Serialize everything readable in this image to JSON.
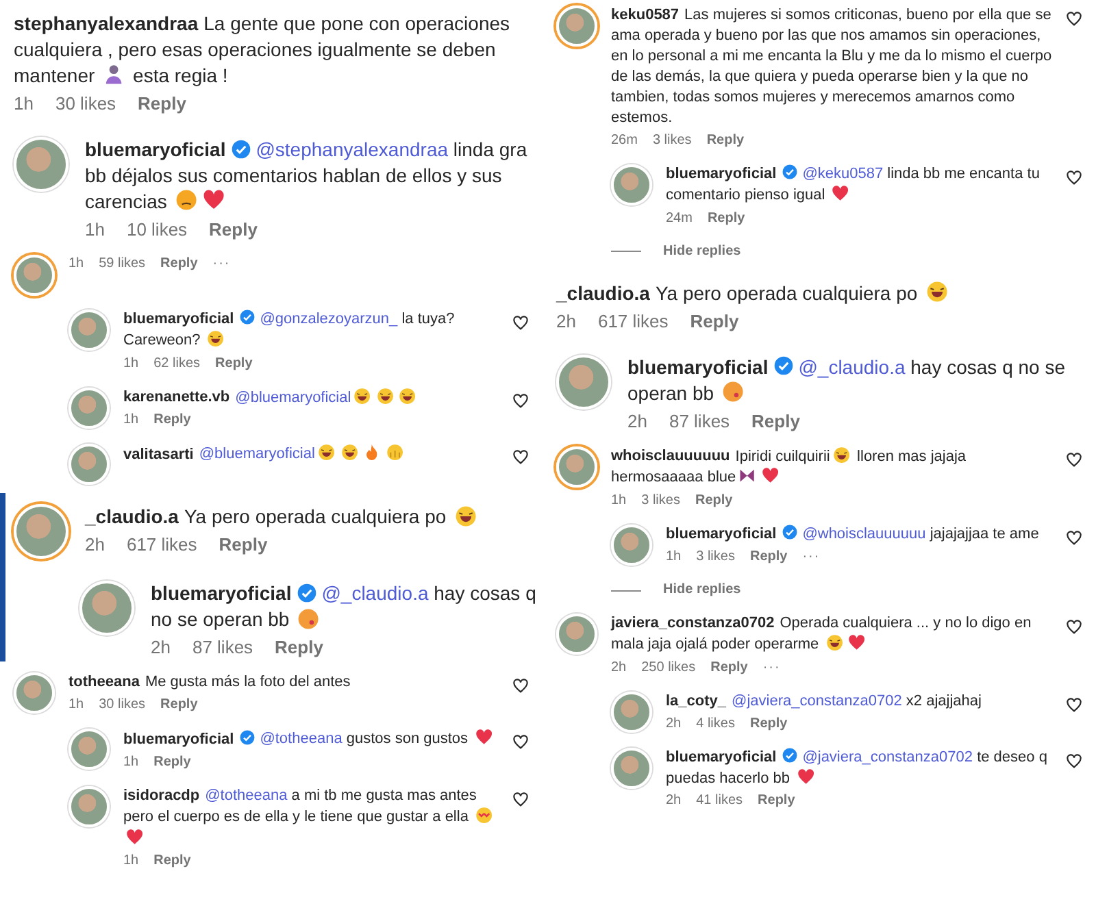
{
  "columns": [
    {
      "panels": [
        {
          "kind": "large",
          "comments": [
            {
              "kind": "comment",
              "user": "stephanyalexandraa",
              "avatar": false,
              "verified": false,
              "reply": false,
              "heart": false,
              "segments": [
                {
                  "kind": "text",
                  "text": "La gente que pone con operaciones cualquiera , pero esas operaciones igualmente se deben mantener "
                },
                {
                  "kind": "person"
                },
                {
                  "kind": "text",
                  "text": " esta regia !"
                }
              ],
              "meta": {
                "time": "1h",
                "likes": "30 likes",
                "reply": "Reply"
              }
            },
            {
              "kind": "comment",
              "user": "bluemaryoficial",
              "avatar": true,
              "ring": false,
              "verified": true,
              "reply": false,
              "heart": false,
              "segments": [
                {
                  "kind": "mention",
                  "text": "@stephanyalexandraa"
                },
                {
                  "kind": "text",
                  "text": " linda gra"
                },
                {
                  "kind": "break"
                },
                {
                  "kind": "text",
                  "text": "bb déjalos sus comentarios hablan de ellos y sus carencias "
                },
                {
                  "kind": "pensive"
                },
                {
                  "kind": "heart"
                }
              ],
              "meta": {
                "time": "1h",
                "likes": "10 likes",
                "reply": "Reply"
              }
            }
          ]
        },
        {
          "kind": "small",
          "comments": [
            {
              "kind": "comment",
              "avatar": true,
              "ring": true,
              "verified": false,
              "reply": false,
              "heart": false,
              "meta": {
                "time": "1h",
                "likes": "59 likes",
                "reply": "Reply",
                "more": "···"
              }
            },
            {
              "kind": "comment",
              "user": "bluemaryoficial",
              "avatar": true,
              "ring": false,
              "verified": true,
              "reply": true,
              "heart": true,
              "segments": [
                {
                  "kind": "mention",
                  "text": "@gonzalezoyarzun_"
                },
                {
                  "kind": "text",
                  "text": " la tuya?"
                },
                {
                  "kind": "break"
                },
                {
                  "kind": "text",
                  "text": "Careweon? "
                },
                {
                  "kind": "laugh"
                }
              ],
              "meta": {
                "time": "1h",
                "likes": "62 likes",
                "reply": "Reply"
              }
            },
            {
              "kind": "comment",
              "user": "karenanette.vb",
              "avatar": true,
              "ring": false,
              "verified": false,
              "reply": true,
              "heart": true,
              "segments": [
                {
                  "kind": "mention",
                  "text": "@bluemaryoficial"
                },
                {
                  "kind": "laugh"
                },
                {
                  "kind": "laugh"
                },
                {
                  "kind": "laugh"
                }
              ],
              "meta": {
                "time": "1h",
                "reply": "Reply"
              }
            },
            {
              "kind": "comment",
              "user": "valitasarti",
              "avatar": true,
              "ring": false,
              "verified": false,
              "reply": true,
              "heart": true,
              "segments": [
                {
                  "kind": "mention",
                  "text": "@bluemaryoficial"
                },
                {
                  "kind": "laugh"
                },
                {
                  "kind": "laugh"
                },
                {
                  "kind": "fire"
                },
                {
                  "kind": "hands"
                }
              ]
            }
          ]
        },
        {
          "kind": "large",
          "left_bar": true,
          "comments": [
            {
              "kind": "comment",
              "user": "_claudio.a",
              "avatar": true,
              "ring": true,
              "verified": false,
              "reply": false,
              "heart": false,
              "segments": [
                {
                  "kind": "text",
                  "text": "Ya pero operada cualquiera po "
                },
                {
                  "kind": "laugh"
                }
              ],
              "meta": {
                "time": "2h",
                "likes": "617 likes",
                "reply": "Reply"
              }
            },
            {
              "kind": "comment",
              "user": "bluemaryoficial",
              "avatar": true,
              "ring": false,
              "verified": true,
              "reply": true,
              "heart": false,
              "segments": [
                {
                  "kind": "mention",
                  "text": "@_claudio.a"
                },
                {
                  "kind": "text",
                  "text": " hay cosas q no se operan bb "
                },
                {
                  "kind": "kiss"
                }
              ],
              "meta": {
                "time": "2h",
                "likes": "87 likes",
                "reply": "Reply"
              }
            }
          ]
        },
        {
          "kind": "small",
          "comments": [
            {
              "kind": "comment",
              "user": "totheeana",
              "avatar": true,
              "ring": false,
              "verified": false,
              "reply": false,
              "heart": true,
              "segments": [
                {
                  "kind": "text",
                  "text": "Me gusta más la foto del antes"
                }
              ],
              "meta": {
                "time": "1h",
                "likes": "30 likes",
                "reply": "Reply"
              }
            },
            {
              "kind": "comment",
              "user": "bluemaryoficial",
              "avatar": true,
              "ring": false,
              "verified": true,
              "reply": true,
              "heart": true,
              "segments": [
                {
                  "kind": "mention",
                  "text": "@totheeana"
                },
                {
                  "kind": "text",
                  "text": " gustos son gustos "
                },
                {
                  "kind": "heart"
                }
              ],
              "meta": {
                "time": "1h",
                "reply": "Reply"
              }
            },
            {
              "kind": "comment",
              "user": "isidoracdp",
              "avatar": true,
              "ring": false,
              "verified": false,
              "reply": true,
              "heart": true,
              "segments": [
                {
                  "kind": "mention",
                  "text": "@totheeana"
                },
                {
                  "kind": "text",
                  "text": " a mi tb me gusta mas antes pero el cuerpo es de ella y le tiene que gustar a ella "
                },
                {
                  "kind": "heart_eyes"
                },
                {
                  "kind": "heart"
                }
              ],
              "meta": {
                "time": "1h",
                "reply": "Reply"
              }
            }
          ]
        }
      ]
    },
    {
      "panels": [
        {
          "kind": "small",
          "comments": [
            {
              "kind": "comment",
              "user": "keku0587",
              "avatar": true,
              "ring": true,
              "verified": false,
              "reply": false,
              "heart": true,
              "segments": [
                {
                  "kind": "text",
                  "text": "Las mujeres si somos criticonas, bueno por ella que se ama operada y bueno por las que nos amamos sin operaciones, en lo personal a mi me encanta la Blu y me da lo mismo el cuerpo de las demás, la que quiera y pueda operarse bien y la que no tambien, todas somos mujeres y merecemos amarnos como estemos."
                }
              ],
              "meta": {
                "time": "26m",
                "likes": "3 likes",
                "reply": "Reply"
              }
            },
            {
              "kind": "comment",
              "user": "bluemaryoficial",
              "avatar": true,
              "ring": false,
              "verified": true,
              "reply": true,
              "heart": true,
              "segments": [
                {
                  "kind": "mention",
                  "text": "@keku0587"
                },
                {
                  "kind": "text",
                  "text": " linda bb me encanta tu comentario pienso igual "
                },
                {
                  "kind": "heart"
                }
              ],
              "meta": {
                "time": "24m",
                "reply": "Reply"
              }
            },
            {
              "kind": "hide",
              "text": "Hide replies"
            }
          ]
        },
        {
          "kind": "large",
          "comments": [
            {
              "kind": "comment",
              "user": "_claudio.a",
              "avatar": false,
              "verified": false,
              "reply": false,
              "heart": false,
              "segments": [
                {
                  "kind": "text",
                  "text": "Ya pero operada cualquiera po "
                },
                {
                  "kind": "laugh"
                }
              ],
              "meta": {
                "time": "2h",
                "likes": "617 likes",
                "reply": "Reply"
              }
            },
            {
              "kind": "comment",
              "user": "bluemaryoficial",
              "avatar": true,
              "ring": false,
              "verified": true,
              "reply": false,
              "heart": false,
              "segments": [
                {
                  "kind": "mention",
                  "text": "@_claudio.a"
                },
                {
                  "kind": "text",
                  "text": " hay cosas q no se operan bb "
                },
                {
                  "kind": "kiss"
                }
              ],
              "meta": {
                "time": "2h",
                "likes": "87 likes",
                "reply": "Reply"
              }
            }
          ]
        },
        {
          "kind": "small",
          "comments": [
            {
              "kind": "comment",
              "user": "whoisclauuuuuu",
              "avatar": true,
              "ring": true,
              "verified": false,
              "reply": false,
              "heart": true,
              "segments": [
                {
                  "kind": "text",
                  "text": "Ipiridi cuilquirii"
                },
                {
                  "kind": "laugh"
                },
                {
                  "kind": "text",
                  "text": " lloren mas jajaja hermosaaaaa blue"
                },
                {
                  "kind": "butterfly"
                },
                {
                  "kind": "heart"
                }
              ],
              "meta": {
                "time": "1h",
                "likes": "3 likes",
                "reply": "Reply"
              }
            },
            {
              "kind": "comment",
              "user": "bluemaryoficial",
              "avatar": true,
              "ring": false,
              "verified": true,
              "reply": true,
              "heart": true,
              "segments": [
                {
                  "kind": "mention",
                  "text": "@whoisclauuuuuu"
                },
                {
                  "kind": "text",
                  "text": " jajajajjaa te ame"
                }
              ],
              "meta": {
                "time": "1h",
                "likes": "3 likes",
                "reply": "Reply",
                "more": "···"
              }
            },
            {
              "kind": "hide",
              "text": "Hide replies"
            },
            {
              "kind": "comment",
              "user": "javiera_constanza0702",
              "avatar": true,
              "ring": false,
              "verified": false,
              "reply": false,
              "heart": true,
              "segments": [
                {
                  "kind": "text",
                  "text": "Operada cualquiera ... y no lo digo en mala jaja ojalá poder operarme "
                },
                {
                  "kind": "laugh"
                },
                {
                  "kind": "heart"
                }
              ],
              "meta": {
                "time": "2h",
                "likes": "250 likes",
                "reply": "Reply",
                "more": "···"
              }
            },
            {
              "kind": "comment",
              "user": "la_coty_",
              "avatar": true,
              "ring": false,
              "verified": false,
              "reply": true,
              "heart": true,
              "segments": [
                {
                  "kind": "mention",
                  "text": "@javiera_constanza0702"
                },
                {
                  "kind": "text",
                  "text": " x2 ajajjahaj"
                }
              ],
              "meta": {
                "time": "2h",
                "likes": "4 likes",
                "reply": "Reply"
              }
            },
            {
              "kind": "comment",
              "user": "bluemaryoficial",
              "avatar": true,
              "ring": false,
              "verified": true,
              "reply": true,
              "heart": true,
              "segments": [
                {
                  "kind": "mention",
                  "text": "@javiera_constanza0702"
                },
                {
                  "kind": "text",
                  "text": " te deseo q puedas hacerlo bb "
                },
                {
                  "kind": "heart"
                }
              ],
              "meta": {
                "time": "2h",
                "likes": "41 likes",
                "reply": "Reply"
              }
            }
          ]
        }
      ]
    }
  ]
}
